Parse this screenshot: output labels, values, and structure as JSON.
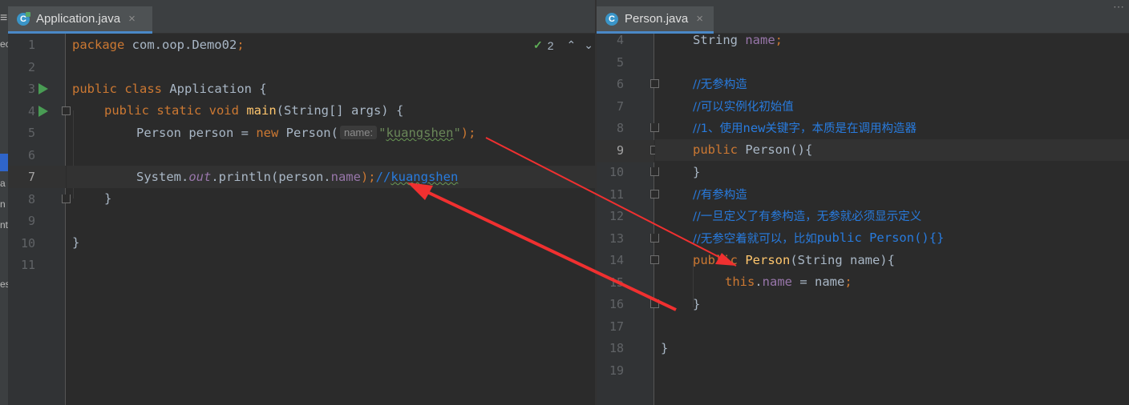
{
  "side_strip": {
    "fragments": [
      "≡",
      "ec",
      "a",
      "n",
      "nt",
      "es"
    ]
  },
  "left_editor": {
    "tab": {
      "label": "Application.java",
      "close": "×",
      "icon": "C"
    },
    "inspection": {
      "count": "2",
      "up": "⌃",
      "down": "⌄"
    },
    "lines": [
      {
        "n": "1"
      },
      {
        "n": "2"
      },
      {
        "n": "3"
      },
      {
        "n": "4"
      },
      {
        "n": "5"
      },
      {
        "n": "6"
      },
      {
        "n": "7"
      },
      {
        "n": "8"
      },
      {
        "n": "9"
      },
      {
        "n": "10"
      },
      {
        "n": "11"
      }
    ],
    "tokens": {
      "l1_kw": "package",
      "l1_rest": " com.oop.Demo02",
      "l1_semi": ";",
      "l3_kw1": "public",
      "l3_kw2": "class",
      "l3_name": " Application {",
      "l4_kw": "public static void",
      "l4_fn": "main",
      "l4_rest": "(String[] args) {",
      "l5_a": "Person person = ",
      "l5_new": "new",
      "l5_b": " Person(",
      "l5_hint": "name:",
      "l5_str_q1": "\"",
      "l5_str_body": "kuangshen",
      "l5_str_q2": "\"",
      "l5_c": ");",
      "l7_a": "System.",
      "l7_out": "out",
      "l7_b": ".println(person.",
      "l7_field": "name",
      "l7_c": ");",
      "l7_cmt1": "//",
      "l7_cmt2": "kuangshen",
      "l8": "}",
      "l10": "}"
    }
  },
  "right_editor": {
    "tab": {
      "label": "Person.java",
      "close": "×",
      "icon": "C"
    },
    "lines": [
      {
        "n": "4"
      },
      {
        "n": "5"
      },
      {
        "n": "6"
      },
      {
        "n": "7"
      },
      {
        "n": "8"
      },
      {
        "n": "9"
      },
      {
        "n": "10"
      },
      {
        "n": "11"
      },
      {
        "n": "12"
      },
      {
        "n": "13"
      },
      {
        "n": "14"
      },
      {
        "n": "15"
      },
      {
        "n": "16"
      },
      {
        "n": "17"
      },
      {
        "n": "18"
      },
      {
        "n": "19"
      }
    ],
    "tokens": {
      "r4_a": "String ",
      "r4_field": "name",
      "r4_semi": ";",
      "r6": "//无参构造",
      "r7": "//可以实例化初始值",
      "r8_a": "//1、使用",
      "r8_b": "new",
      "r8_c": "关键字，本质是在调用构造器",
      "r9_kw": "public",
      "r9_name": " Person",
      "r9_rest": "(){",
      "r10": "}",
      "r11": "//有参构造",
      "r12": "//一旦定义了有参构造，无参就必须显示定义",
      "r13_a": "//无参空着就可以，比如",
      "r13_b": "public Person(){}",
      "r14_kw": "public",
      "r14_fn": " Person",
      "r14_rest": "(String name){",
      "r15_kw": "this",
      "r15_dot": ".",
      "r15_field": "name",
      "r15_rest": " = name",
      "r15_semi": ";",
      "r16": "}",
      "r18": "}"
    }
  },
  "colors": {
    "annotation_arrow": "#f03030",
    "keyword": "#cc7832",
    "comment": "#287bde",
    "string": "#6a8759",
    "field": "#9876aa"
  }
}
